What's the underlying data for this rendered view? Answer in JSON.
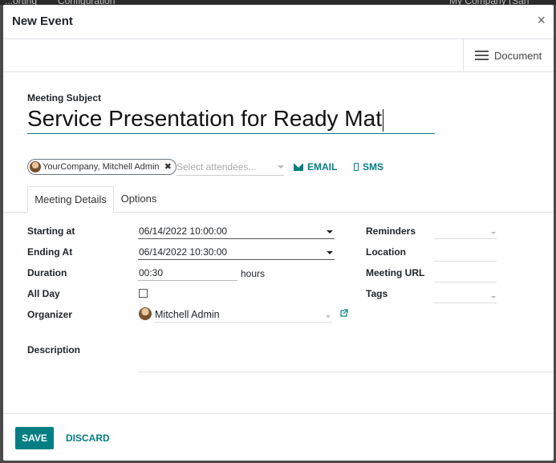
{
  "background": {
    "left_items": [
      "...orting",
      "Configuration"
    ],
    "right_item": "My Company (San Fran..."
  },
  "modal": {
    "title": "New Event",
    "close_glyph": "×"
  },
  "statusbar": {
    "document_label": "Document"
  },
  "subject": {
    "label": "Meeting Subject",
    "value": "Service Presentation for Ready Mat"
  },
  "attendees": {
    "chips": [
      {
        "label": "YourCompany, Mitchell Admin",
        "remove_glyph": "✖"
      }
    ],
    "placeholder": "Select attendees...",
    "email_label": "EMAIL",
    "sms_label": "SMS"
  },
  "tabs": [
    {
      "label": "Meeting Details",
      "active": true
    },
    {
      "label": "Options",
      "active": false
    }
  ],
  "details": {
    "starting_at": {
      "label": "Starting at",
      "value": "06/14/2022 10:00:00"
    },
    "ending_at": {
      "label": "Ending At",
      "value": "06/14/2022 10:30:00"
    },
    "duration": {
      "label": "Duration",
      "value": "00:30",
      "unit": "hours"
    },
    "all_day": {
      "label": "All Day",
      "checked": false
    },
    "organizer": {
      "label": "Organizer",
      "value": "Mitchell Admin"
    },
    "reminders": {
      "label": "Reminders",
      "value": ""
    },
    "location": {
      "label": "Location",
      "value": ""
    },
    "meeting_url": {
      "label": "Meeting URL",
      "value": ""
    },
    "tags": {
      "label": "Tags",
      "value": ""
    },
    "description": {
      "label": "Description",
      "value": ""
    }
  },
  "footer": {
    "save_label": "SAVE",
    "discard_label": "DISCARD"
  },
  "colors": {
    "accent": "#017e84",
    "text": "#212529",
    "border": "#dee2e6"
  }
}
